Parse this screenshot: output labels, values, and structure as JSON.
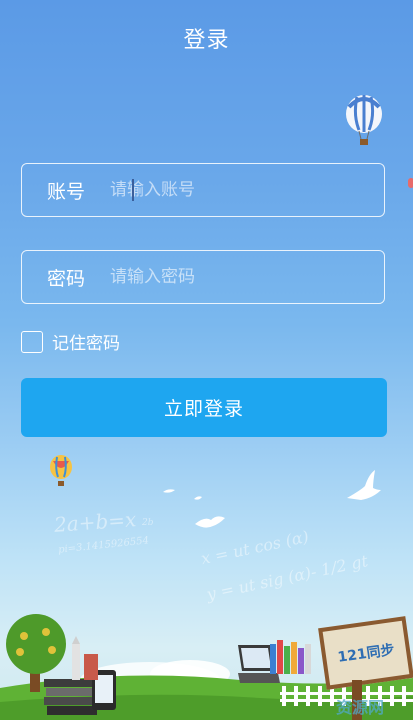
{
  "header": {
    "title": "登录"
  },
  "account": {
    "label": "账号",
    "placeholder": "请输入账号"
  },
  "password": {
    "label": "密码",
    "placeholder": "请输入密码"
  },
  "remember": {
    "label": "记住密码",
    "checked": false
  },
  "login_button": {
    "label": "立即登录"
  },
  "background": {
    "formulas": [
      "2a+b=x",
      "2b",
      "pi=3.1415926554",
      "x = ut cos (α)",
      "y = ut sig (α)- 1/2 gt"
    ],
    "sign_text": "121同步",
    "watermark": "资源网"
  },
  "colors": {
    "accent": "#1ea6f0",
    "background_top": "#5b9ae6",
    "background_bottom": "#cfe9ef"
  }
}
